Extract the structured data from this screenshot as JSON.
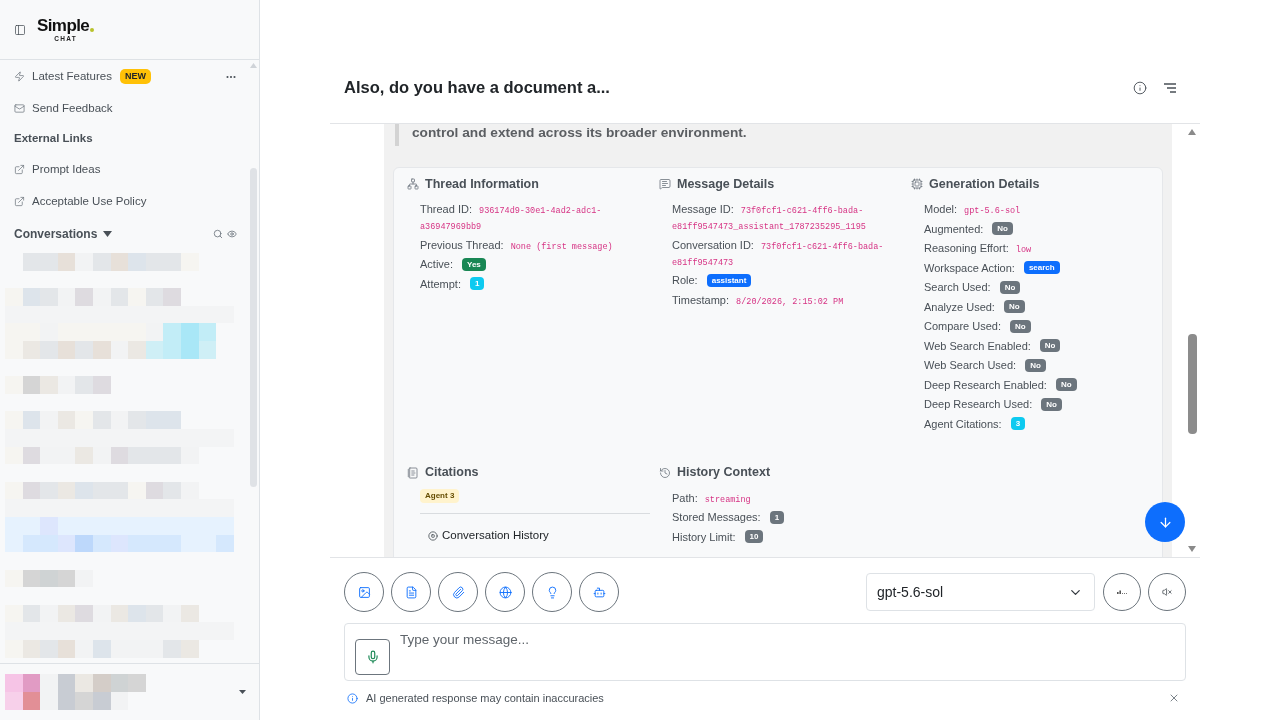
{
  "sidebar": {
    "logo": {
      "name": "Simple",
      "tagline": "CHAT"
    },
    "menu": [
      {
        "kind": "features",
        "label": "Latest Features",
        "badge": "NEW"
      },
      {
        "kind": "feedback",
        "label": "Send Feedback"
      }
    ],
    "external_links": {
      "heading": "External Links",
      "items": [
        {
          "label": "Prompt Ideas"
        },
        {
          "label": "Acceptable Use Policy"
        }
      ]
    },
    "conversations": {
      "heading": "Conversations",
      "expanded": true
    }
  },
  "chat": {
    "title": "Also, do you have a document a...",
    "quote": "control and extend across its broader environment.",
    "sections": [
      {
        "kind": "thread",
        "title": "Thread Information",
        "rows": [
          {
            "kind": "code",
            "label": "Thread ID:",
            "value": "936174d9-30e1-4ad2-adc1-a36947969bb9"
          },
          {
            "kind": "code",
            "label": "Previous Thread:",
            "value": "None (first message)"
          },
          {
            "kind": "badge",
            "label": "Active:",
            "value": "Yes",
            "color": "#198754"
          },
          {
            "kind": "badge",
            "label": "Attempt:",
            "value": "1",
            "color": "#0dcaf0"
          }
        ]
      },
      {
        "kind": "message",
        "title": "Message Details",
        "rows": [
          {
            "kind": "code",
            "label": "Message ID:",
            "value": "73f0fcf1-c621-4ff6-bada-e81ff9547473_assistant_1787235295_1195"
          },
          {
            "kind": "code",
            "label": "Conversation ID:",
            "value": "73f0fcf1-c621-4ff6-bada-e81ff9547473"
          },
          {
            "kind": "badge",
            "label": "Role:",
            "value": "assistant",
            "color": "#0d6efd"
          },
          {
            "kind": "code",
            "label": "Timestamp:",
            "value": "8/20/2026, 2:15:02 PM"
          }
        ]
      },
      {
        "kind": "generation",
        "title": "Generation Details",
        "rows": [
          {
            "kind": "code",
            "label": "Model:",
            "value": "gpt-5.6-sol"
          },
          {
            "kind": "badge",
            "label": "Augmented:",
            "value": "No",
            "color": "#6c757d"
          },
          {
            "kind": "code",
            "label": "Reasoning Effort:",
            "value": "low"
          },
          {
            "kind": "badge",
            "label": "Workspace Action:",
            "value": "search",
            "color": "#0d6efd"
          },
          {
            "kind": "badge",
            "label": "Search Used:",
            "value": "No",
            "color": "#6c757d"
          },
          {
            "kind": "badge",
            "label": "Analyze Used:",
            "value": "No",
            "color": "#6c757d"
          },
          {
            "kind": "badge",
            "label": "Compare Used:",
            "value": "No",
            "color": "#6c757d"
          },
          {
            "kind": "badge",
            "label": "Web Search Enabled:",
            "value": "No",
            "color": "#6c757d"
          },
          {
            "kind": "badge",
            "label": "Web Search Used:",
            "value": "No",
            "color": "#6c757d"
          },
          {
            "kind": "badge",
            "label": "Deep Research Enabled:",
            "value": "No",
            "color": "#6c757d"
          },
          {
            "kind": "badge",
            "label": "Deep Research Used:",
            "value": "No",
            "color": "#6c757d"
          },
          {
            "kind": "badge",
            "label": "Agent Citations:",
            "value": "3",
            "color": "#0dcaf0"
          }
        ]
      },
      {
        "kind": "citations",
        "title": "Citations",
        "tags": [
          {
            "text": "Agent 3",
            "color": "#fff3cd"
          }
        ],
        "items": [
          {
            "label": "Conversation History"
          }
        ]
      },
      {
        "kind": "history",
        "title": "History Context",
        "rows": [
          {
            "kind": "code",
            "label": "Path:",
            "value": "streaming"
          },
          {
            "kind": "badge",
            "label": "Stored Messages:",
            "value": "1",
            "color": "#6c757d"
          },
          {
            "kind": "badge",
            "label": "History Limit:",
            "value": "10",
            "color": "#6c757d"
          }
        ]
      }
    ],
    "model_select": {
      "value": "gpt-5.6-sol"
    },
    "input": {
      "placeholder": "Type your message..."
    },
    "disclaimer": "AI generated response may contain inaccuracies"
  }
}
